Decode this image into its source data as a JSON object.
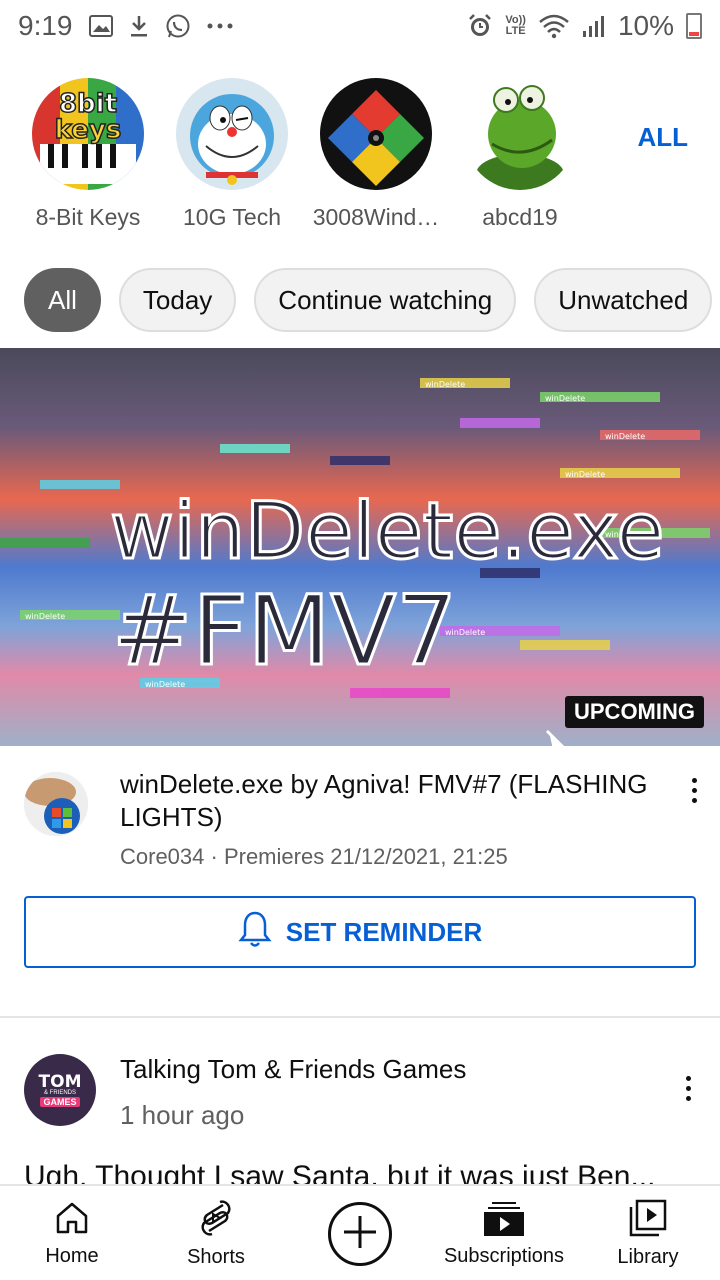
{
  "status_bar": {
    "time": "9:19",
    "battery": "10%",
    "net_top": "Vo))",
    "net_bottom": "LTE"
  },
  "channels": {
    "items": [
      {
        "name": "8-Bit Keys",
        "logo_top": "8bit",
        "logo_bottom": "keys"
      },
      {
        "name": "10G Tech"
      },
      {
        "name": "3008Wind…"
      },
      {
        "name": "abcd19"
      }
    ],
    "all_label": "ALL"
  },
  "chips": [
    "All",
    "Today",
    "Continue watching",
    "Unwatched"
  ],
  "video": {
    "thumb_line1": "winDelete.exe",
    "thumb_line2": "#FMV7",
    "thumb_noise_label": "winDelete",
    "badge": "UPCOMING",
    "title": "winDelete.exe by Agniva! FMV#7 (FLASHING LIGHTS)",
    "meta": "Core034 · Premieres 21/12/2021, 21:25",
    "reminder_label": "SET REMINDER"
  },
  "post": {
    "avatar_l1": "TOM",
    "avatar_l2": "& FRIENDS",
    "avatar_l3": "GAMES",
    "channel": "Talking Tom & Friends Games",
    "time": "1 hour ago",
    "text": "Ugh. Thought I saw Santa, but it was just Ben..."
  },
  "nav": {
    "home": "Home",
    "shorts": "Shorts",
    "subscriptions": "Subscriptions",
    "library": "Library"
  },
  "colors": {
    "accent_blue": "#065fd4",
    "chip_active": "#606060"
  }
}
